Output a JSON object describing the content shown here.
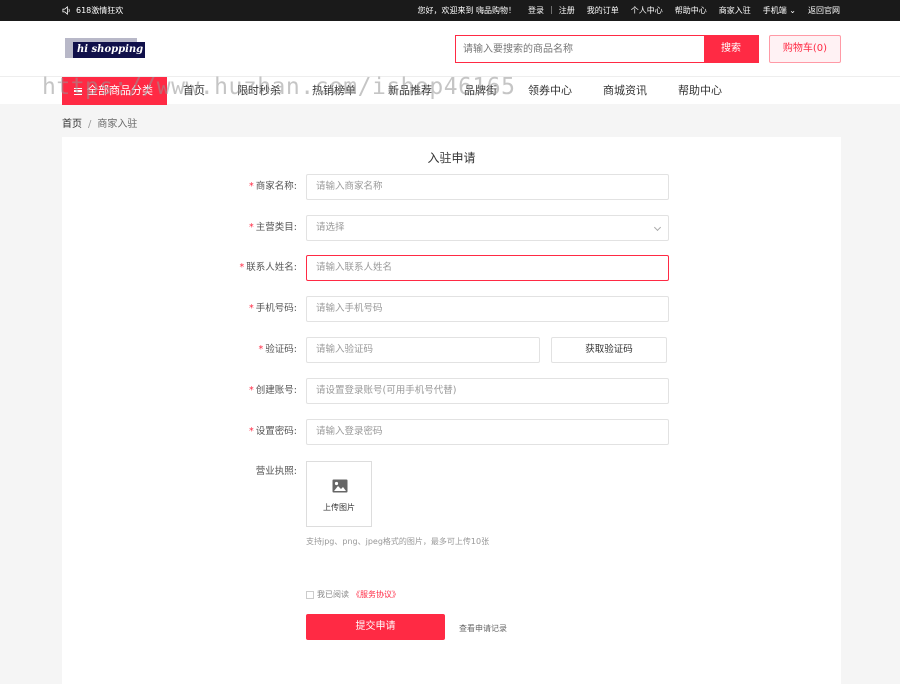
{
  "topbar": {
    "promo": "618激情狂欢",
    "welcome": "您好，欢迎来到 嗨品购物！",
    "login": "登录",
    "sep": "|",
    "register": "注册",
    "orders": "我的订单",
    "profile": "个人中心",
    "help": "帮助中心",
    "merchant": "商家入驻",
    "mobile": "手机端",
    "official": "返回官网"
  },
  "header": {
    "logo_text": "hi shopping",
    "search_placeholder": "请输入要搜索的商品名称",
    "search_button": "搜索",
    "cart": "购物车(0)"
  },
  "nav": {
    "all_categories": "全部商品分类",
    "items": [
      "首页",
      "限时秒杀",
      "热销榜单",
      "新品推荐",
      "品牌街",
      "领券中心",
      "商城资讯",
      "帮助中心"
    ]
  },
  "watermark": "https://www.huzhan.com/ishop46165",
  "breadcrumb": {
    "home": "首页",
    "sep": "/",
    "current": "商家入驻"
  },
  "form": {
    "title": "入驻申请",
    "required_mark": "*",
    "fields": [
      {
        "label": "商家名称:",
        "placeholder": "请输入商家名称"
      },
      {
        "label": "主营类目:",
        "placeholder": "请选择"
      },
      {
        "label": "联系人姓名:",
        "placeholder": "请输入联系人姓名"
      },
      {
        "label": "手机号码:",
        "placeholder": "请输入手机号码"
      },
      {
        "label": "验证码:",
        "placeholder": "请输入验证码"
      },
      {
        "label": "创建账号:",
        "placeholder": "请设置登录账号(可用手机号代替)"
      },
      {
        "label": "设置密码:",
        "placeholder": "请输入登录密码"
      }
    ],
    "get_code": "获取验证码",
    "license_label": "营业执照:",
    "upload_text": "上传图片",
    "upload_hint": "支持jpg、png、jpeg格式的图片，最多可上传10张",
    "agree_text": "我已阅读",
    "agree_link": "《服务协议》",
    "submit": "提交申请",
    "records": "查看申请记录"
  },
  "colors": {
    "accent": "#ff2a44",
    "topbar_bg": "#1a1a1a"
  }
}
